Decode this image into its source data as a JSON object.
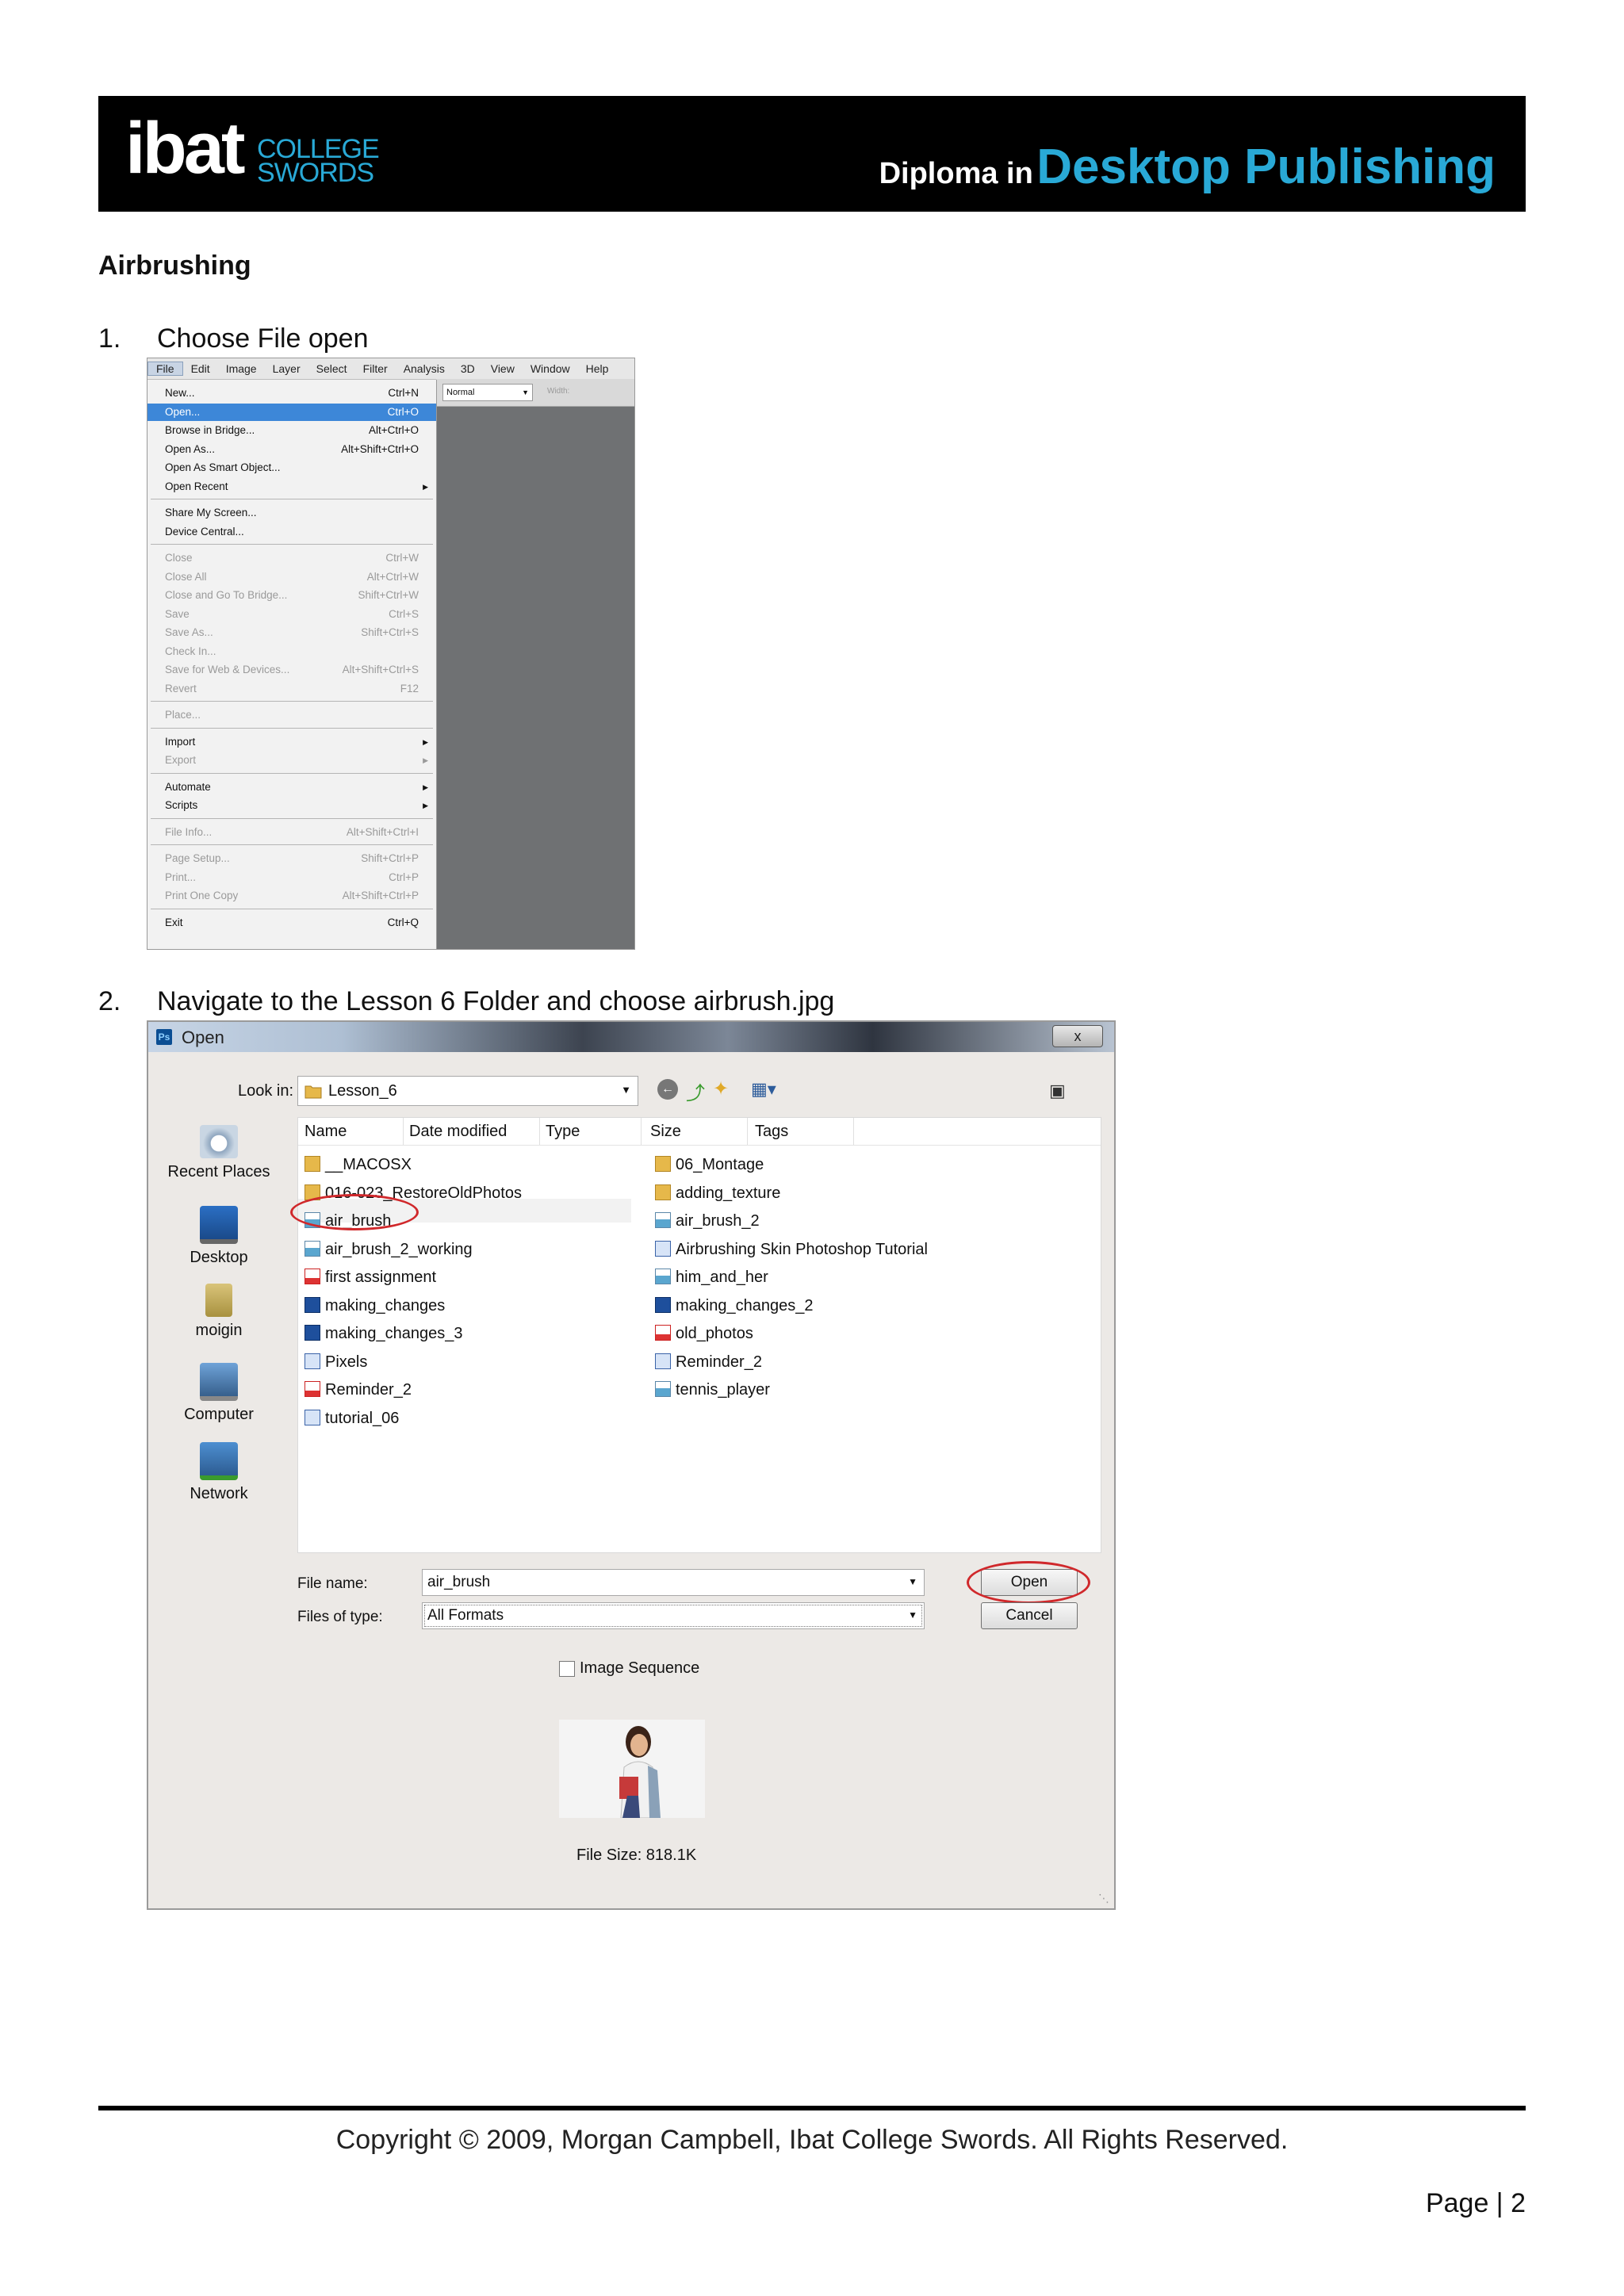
{
  "header": {
    "logo_main": "ibat",
    "logo_line1": "COLLEGE",
    "logo_line2": "SWORDS",
    "title_prefix": "Diploma in",
    "title_main": "Desktop Publishing"
  },
  "heading": "Airbrushing",
  "steps": [
    {
      "number": "1.",
      "text": "Choose File open"
    },
    {
      "number": "2.",
      "text": "Navigate to the Lesson 6 Folder and choose airbrush.jpg"
    }
  ],
  "photoshop": {
    "menubar": [
      "File",
      "Edit",
      "Image",
      "Layer",
      "Select",
      "Filter",
      "Analysis",
      "3D",
      "View",
      "Window",
      "Help"
    ],
    "options": {
      "mode": "Normal",
      "width_label": "Width:"
    },
    "file_menu": [
      {
        "label": "New...",
        "shortcut": "Ctrl+N"
      },
      {
        "label": "Open...",
        "shortcut": "Ctrl+O",
        "highlighted": true
      },
      {
        "label": "Browse in Bridge...",
        "shortcut": "Alt+Ctrl+O"
      },
      {
        "label": "Open As...",
        "shortcut": "Alt+Shift+Ctrl+O"
      },
      {
        "label": "Open As Smart Object...",
        "shortcut": ""
      },
      {
        "label": "Open Recent",
        "shortcut": "",
        "submenu": true
      },
      {
        "separator": true
      },
      {
        "label": "Share My Screen...",
        "shortcut": ""
      },
      {
        "label": "Device Central...",
        "shortcut": ""
      },
      {
        "separator": true
      },
      {
        "label": "Close",
        "shortcut": "Ctrl+W",
        "disabled": true
      },
      {
        "label": "Close All",
        "shortcut": "Alt+Ctrl+W",
        "disabled": true
      },
      {
        "label": "Close and Go To Bridge...",
        "shortcut": "Shift+Ctrl+W",
        "disabled": true
      },
      {
        "label": "Save",
        "shortcut": "Ctrl+S",
        "disabled": true
      },
      {
        "label": "Save As...",
        "shortcut": "Shift+Ctrl+S",
        "disabled": true
      },
      {
        "label": "Check In...",
        "shortcut": "",
        "disabled": true
      },
      {
        "label": "Save for Web & Devices...",
        "shortcut": "Alt+Shift+Ctrl+S",
        "disabled": true
      },
      {
        "label": "Revert",
        "shortcut": "F12",
        "disabled": true
      },
      {
        "separator": true
      },
      {
        "label": "Place...",
        "shortcut": "",
        "disabled": true
      },
      {
        "separator": true
      },
      {
        "label": "Import",
        "shortcut": "",
        "submenu": true
      },
      {
        "label": "Export",
        "shortcut": "",
        "submenu": true,
        "disabled": true
      },
      {
        "separator": true
      },
      {
        "label": "Automate",
        "shortcut": "",
        "submenu": true
      },
      {
        "label": "Scripts",
        "shortcut": "",
        "submenu": true
      },
      {
        "separator": true
      },
      {
        "label": "File Info...",
        "shortcut": "Alt+Shift+Ctrl+I",
        "disabled": true
      },
      {
        "separator": true
      },
      {
        "label": "Page Setup...",
        "shortcut": "Shift+Ctrl+P",
        "disabled": true
      },
      {
        "label": "Print...",
        "shortcut": "Ctrl+P",
        "disabled": true
      },
      {
        "label": "Print One Copy",
        "shortcut": "Alt+Shift+Ctrl+P",
        "disabled": true
      },
      {
        "separator": true
      },
      {
        "label": "Exit",
        "shortcut": "Ctrl+Q"
      }
    ]
  },
  "dialog": {
    "title": "Open",
    "close_glyph": "x",
    "look_in_label": "Look in:",
    "look_in_value": "Lesson_6",
    "places": [
      "Recent Places",
      "Desktop",
      "moigin",
      "Computer",
      "Network"
    ],
    "columns": [
      "Name",
      "Date modified",
      "Type",
      "Size",
      "Tags"
    ],
    "files_left": [
      {
        "name": "__MACOSX",
        "kind": "folder"
      },
      {
        "name": "016-023_RestoreOldPhotos",
        "kind": "folder"
      },
      {
        "name": "air_brush",
        "kind": "jpg",
        "selected": true
      },
      {
        "name": "air_brush_2_working",
        "kind": "jpg"
      },
      {
        "name": "first assignment",
        "kind": "pdf"
      },
      {
        "name": "making_changes",
        "kind": "psd"
      },
      {
        "name": "making_changes_3",
        "kind": "psd"
      },
      {
        "name": "Pixels",
        "kind": "doc"
      },
      {
        "name": "Reminder_2",
        "kind": "pdf"
      },
      {
        "name": "tutorial_06",
        "kind": "doc"
      }
    ],
    "files_right": [
      {
        "name": "06_Montage",
        "kind": "folder"
      },
      {
        "name": "adding_texture",
        "kind": "folder"
      },
      {
        "name": "air_brush_2",
        "kind": "jpg"
      },
      {
        "name": "Airbrushing Skin Photoshop Tutorial",
        "kind": "doc"
      },
      {
        "name": "him_and_her",
        "kind": "jpg"
      },
      {
        "name": "making_changes_2",
        "kind": "psd"
      },
      {
        "name": "old_photos",
        "kind": "pdf"
      },
      {
        "name": "Reminder_2",
        "kind": "doc"
      },
      {
        "name": "tennis_player",
        "kind": "jpg"
      }
    ],
    "file_name_label": "File name:",
    "file_name_value": "air_brush",
    "file_type_label": "Files of type:",
    "file_type_value": "All Formats",
    "open_button": "Open",
    "cancel_button": "Cancel",
    "image_sequence_label": "Image Sequence",
    "file_size": "File Size: 818.1K"
  },
  "footer": {
    "copyright": "Copyright © 2009, Morgan Campbell, Ibat College Swords. All Rights Reserved.",
    "page": "Page | 2"
  }
}
